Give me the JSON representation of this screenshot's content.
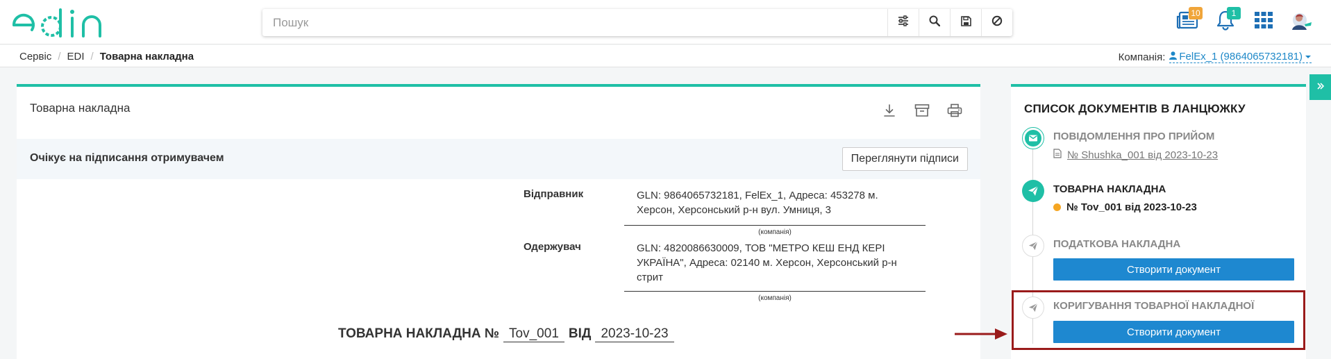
{
  "header": {
    "logo_text": "edin",
    "search_placeholder": "Пошук",
    "notifications": {
      "news_count": "10",
      "bell_count": "1"
    }
  },
  "breadcrumb": {
    "items": [
      "Сервіс",
      "EDI"
    ],
    "current": "Товарна накладна"
  },
  "company": {
    "label": "Компанія:",
    "value": "FelEx_1 (9864065732181)"
  },
  "document": {
    "title": "Товарна накладна",
    "status": "Очікує на підписання отримувачем",
    "view_signatures_label": "Переглянути підписи",
    "sender_label": "Відправник",
    "sender_value": "GLN: 9864065732181, FelEx_1, Адреса: 453278 м. Херсон, Херсонський р-н вул. Умниця, 3",
    "receiver_label": "Одержувач",
    "receiver_value": "GLN: 4820086630009, ТОВ \"МЕТРО КЕШ ЕНД КЕРІ УКРАЇНА\", Адреса: 02140 м. Херсон, Херсонський р-н стрит",
    "caption": "(компанія)",
    "heading_prefix": "ТОВАРНА НАКЛАДНА №",
    "number": "Tov_001",
    "date_label": "ВІД",
    "date": "2023-10-23"
  },
  "chain": {
    "title": "СПИСОК ДОКУМЕНТІВ В ЛАНЦЮЖКУ",
    "steps": [
      {
        "title": "ПОВІДОМЛЕННЯ ПРО ПРИЙОМ",
        "sub": "№ Shushka_001 від 2023-10-23"
      },
      {
        "title": "ТОВАРНА НАКЛАДНА",
        "sub": "№ Tov_001 від 2023-10-23"
      },
      {
        "title": "ПОДАТКОВА НАКЛАДНА",
        "button": "Створити документ"
      },
      {
        "title": "КОРИГУВАННЯ ТОВАРНОЇ НАКЛАДНОЇ",
        "button": "Створити документ"
      }
    ]
  },
  "colors": {
    "accent": "#1fbfa6",
    "primary_button": "#1e88d0",
    "highlight": "#9a1b1b",
    "pending_dot": "#f5a623",
    "link": "#1e88c8"
  }
}
